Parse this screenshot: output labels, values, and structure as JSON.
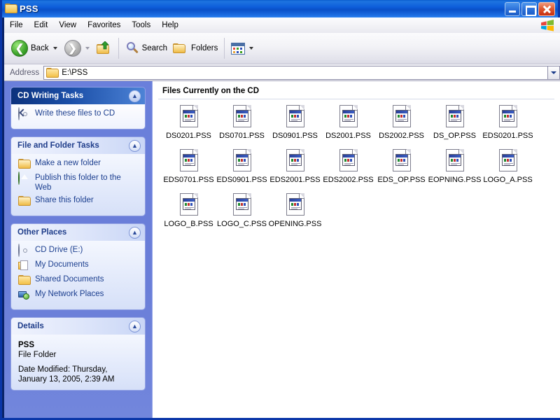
{
  "window": {
    "title": "PSS",
    "icon": "folder-icon",
    "buttons": {
      "minimize": "Minimize",
      "maximize": "Maximize",
      "close": "Close"
    }
  },
  "menu": {
    "items": [
      {
        "label": "File"
      },
      {
        "label": "Edit"
      },
      {
        "label": "View"
      },
      {
        "label": "Favorites"
      },
      {
        "label": "Tools"
      },
      {
        "label": "Help"
      }
    ],
    "branding_icon": "windows-flag-icon"
  },
  "toolbar": {
    "back_label": "Back",
    "back_icon": "back-arrow-icon",
    "forward_icon": "forward-arrow-icon",
    "up_icon": "up-folder-icon",
    "search_label": "Search",
    "search_icon": "magnifier-icon",
    "folders_label": "Folders",
    "folders_icon": "folders-icon",
    "views_icon": "views-icon"
  },
  "address": {
    "label": "Address",
    "value": "E:\\PSS",
    "icon": "folder-icon",
    "dropdown_icon": "chevron-down-icon"
  },
  "sidebar": {
    "panels": [
      {
        "title": "CD Writing Tasks",
        "style": "active",
        "collapse_icon": "chevron-up-icon",
        "links": [
          {
            "label": "Write these files to CD",
            "icon": "cd-burn-icon"
          }
        ]
      },
      {
        "title": "File and Folder Tasks",
        "style": "normal",
        "collapse_icon": "chevron-up-icon",
        "links": [
          {
            "label": "Make a new folder",
            "icon": "new-folder-icon"
          },
          {
            "label": "Publish this folder to the Web",
            "icon": "publish-web-icon"
          },
          {
            "label": "Share this folder",
            "icon": "share-folder-icon"
          }
        ]
      },
      {
        "title": "Other Places",
        "style": "normal",
        "collapse_icon": "chevron-up-icon",
        "links": [
          {
            "label": "CD Drive (E:)",
            "icon": "cd-drive-icon"
          },
          {
            "label": "My Documents",
            "icon": "my-documents-icon"
          },
          {
            "label": "Shared Documents",
            "icon": "shared-documents-icon"
          },
          {
            "label": "My Network Places",
            "icon": "network-places-icon"
          }
        ]
      },
      {
        "title": "Details",
        "style": "normal",
        "collapse_icon": "chevron-up-icon",
        "details": {
          "name": "PSS",
          "type": "File Folder",
          "date_modified": "Date Modified: Thursday, January 13, 2005, 2:39 AM"
        }
      }
    ]
  },
  "filepane": {
    "group_header": "Files Currently on the CD",
    "files": [
      {
        "name": "DS0201.PSS",
        "icon": "pss-document-icon"
      },
      {
        "name": "DS0701.PSS",
        "icon": "pss-document-icon"
      },
      {
        "name": "DS0901.PSS",
        "icon": "pss-document-icon"
      },
      {
        "name": "DS2001.PSS",
        "icon": "pss-document-icon"
      },
      {
        "name": "DS2002.PSS",
        "icon": "pss-document-icon"
      },
      {
        "name": "DS_OP.PSS",
        "icon": "pss-document-icon"
      },
      {
        "name": "EDS0201.PSS",
        "icon": "pss-document-icon"
      },
      {
        "name": "EDS0701.PSS",
        "icon": "pss-document-icon"
      },
      {
        "name": "EDS0901.PSS",
        "icon": "pss-document-icon"
      },
      {
        "name": "EDS2001.PSS",
        "icon": "pss-document-icon"
      },
      {
        "name": "EDS2002.PSS",
        "icon": "pss-document-icon"
      },
      {
        "name": "EDS_OP.PSS",
        "icon": "pss-document-icon"
      },
      {
        "name": "EOPNING.PSS",
        "icon": "pss-document-icon"
      },
      {
        "name": "LOGO_A.PSS",
        "icon": "pss-document-icon"
      },
      {
        "name": "LOGO_B.PSS",
        "icon": "pss-document-icon"
      },
      {
        "name": "LOGO_C.PSS",
        "icon": "pss-document-icon"
      },
      {
        "name": "OPENING.PSS",
        "icon": "pss-document-icon"
      }
    ]
  },
  "colors": {
    "titlebar_blue": "#0A50C8",
    "window_border": "#0A36A8",
    "sidebar_blue": "#6A7FDB",
    "panel_header_active": "#0C327D",
    "link_text": "#1C3F8F",
    "close_red": "#C62F12"
  }
}
